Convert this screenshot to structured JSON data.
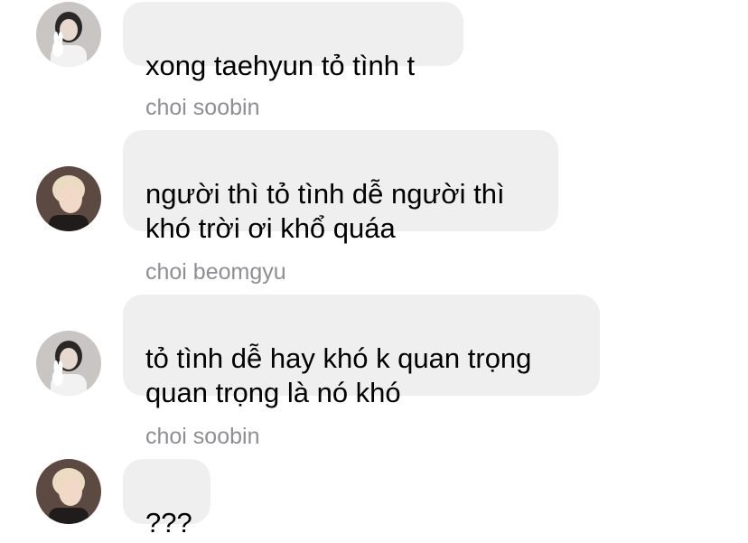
{
  "messages": [
    {
      "sender": "",
      "avatar": "taehyun-avatar",
      "text": "xong taehyun tỏ tình t"
    },
    {
      "sender": "choi soobin",
      "avatar": "soobin-avatar",
      "text": "người thì tỏ tình dễ người thì\nkhó trời ơi khổ quáa"
    },
    {
      "sender": "choi beomgyu",
      "avatar": "beomgyu-avatar",
      "text": "tỏ tình dễ hay khó k quan trọng\nquan trọng là nó khó"
    },
    {
      "sender": "choi soobin",
      "avatar": "soobin-avatar",
      "text": "???"
    }
  ],
  "colors": {
    "bubble": "#efefef",
    "sender_name": "#8e8e93",
    "text": "#000000"
  }
}
